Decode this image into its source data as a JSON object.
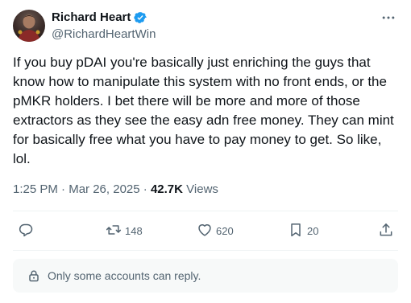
{
  "author": {
    "name": "Richard Heart",
    "handle": "@RichardHeartWin",
    "verified": true,
    "avatar_icon": "profile-photo"
  },
  "tweet": {
    "text": "If you buy pDAI you're basically just enriching the guys that know how to manipulate this system with no front ends, or the pMKR holders. I bet there will be more and more of those extractors as they see the easy adn free money. They can mint for basically free what you have to pay money to get. So like, lol."
  },
  "meta": {
    "time": "1:25 PM",
    "separator": "·",
    "date": "Mar 26, 2025",
    "views_count": "42.7K",
    "views_label": "Views"
  },
  "actions": {
    "reply": {
      "icon": "reply-icon"
    },
    "retweet": {
      "icon": "retweet-icon",
      "count": "148"
    },
    "like": {
      "icon": "heart-icon",
      "count": "620"
    },
    "bookmark": {
      "icon": "bookmark-icon",
      "count": "20"
    },
    "share": {
      "icon": "share-icon"
    }
  },
  "reply_restriction": {
    "icon": "lock-icon",
    "text": "Only some accounts can reply."
  },
  "colors": {
    "text_primary": "#0f1419",
    "text_secondary": "#536471",
    "verified_blue": "#1d9bf0",
    "divider": "#eff3f4",
    "reply_box_bg": "#f7f9f9"
  }
}
